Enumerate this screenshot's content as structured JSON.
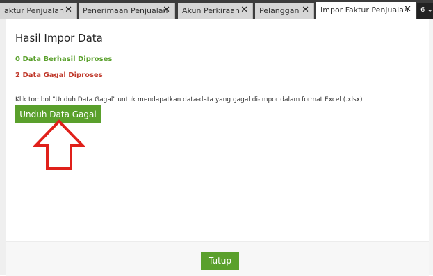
{
  "tabs": [
    {
      "label": "aktur Penjualan",
      "close": "✕"
    },
    {
      "label": "Penerimaan Penjualan",
      "close": "✕"
    },
    {
      "label": "Akun Perkiraan",
      "close": "✕"
    },
    {
      "label": "Pelanggan",
      "close": "✕"
    },
    {
      "label": "Impor Faktur Penjualan",
      "close": "✕"
    }
  ],
  "tab_overflow": "6 ⌄",
  "dialog": {
    "title": "Hasil Impor Data",
    "success_text": "0 Data Berhasil Diproses",
    "failed_text": "2 Data Gagal Diproses",
    "info_text": "Klik tombol \"Unduh Data Gagal\" untuk mendapatkan data-data yang gagal di-impor dalam format Excel (.xlsx)",
    "download_button": "Unduh Data Gagal",
    "close_button": "Tutup"
  },
  "colors": {
    "accent_green": "#5aa02c",
    "error_red": "#c0392b",
    "arrow_red": "#e0201a"
  }
}
